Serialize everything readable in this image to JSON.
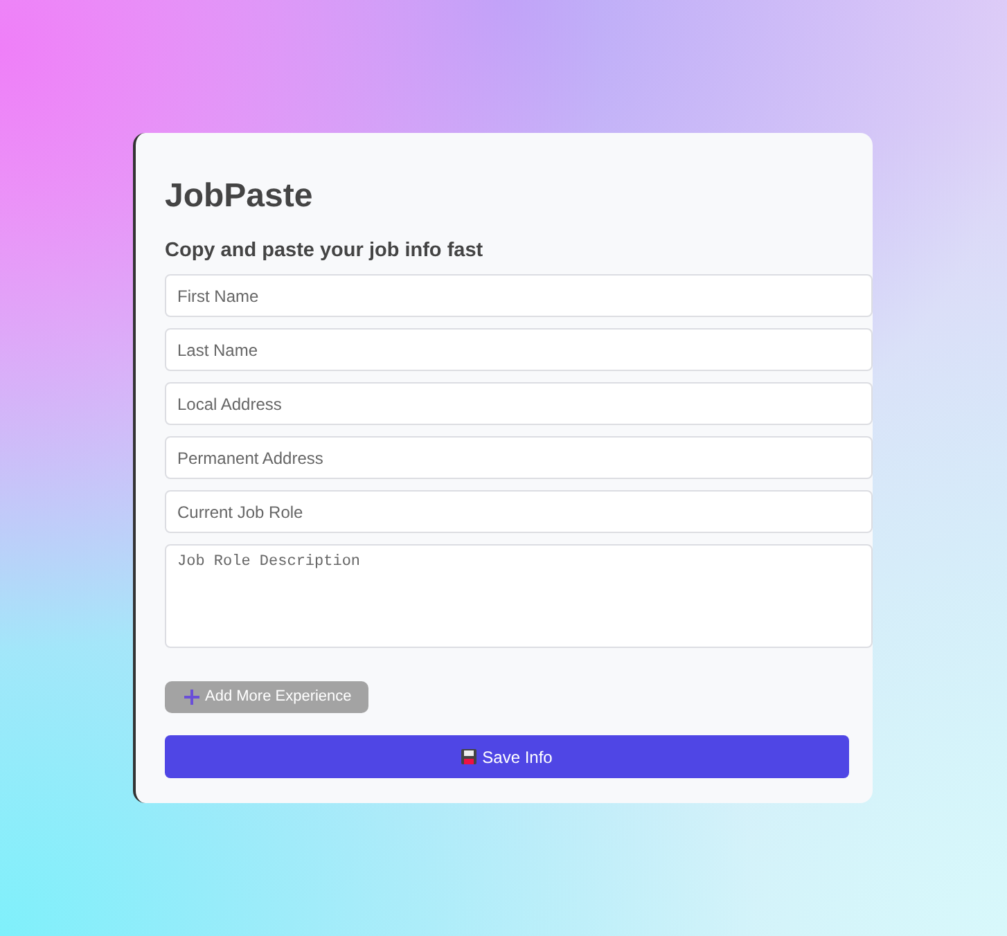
{
  "title": "JobPaste",
  "subtitle": "Copy and paste your job info fast",
  "fields": [
    {
      "kind": "input",
      "placeholder": "First Name"
    },
    {
      "kind": "input",
      "placeholder": "Last Name"
    },
    {
      "kind": "input",
      "placeholder": "Local Address"
    },
    {
      "kind": "input",
      "placeholder": "Permanent Address"
    },
    {
      "kind": "input",
      "placeholder": "Current Job Role"
    },
    {
      "kind": "textarea",
      "placeholder": "Job Role Description"
    }
  ],
  "add_button": {
    "label": "Add More Experience"
  },
  "save_button": {
    "label": "Save Info"
  }
}
